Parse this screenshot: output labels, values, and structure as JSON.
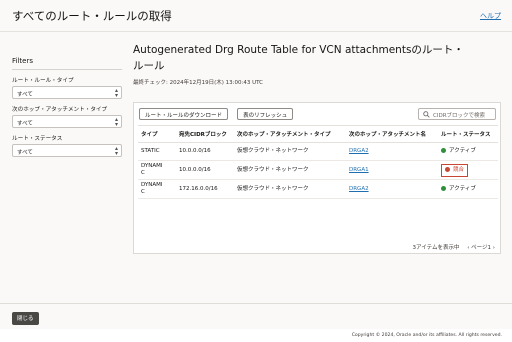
{
  "header": {
    "title": "すべてのルート・ルールの取得",
    "help": "ヘルプ"
  },
  "filters": {
    "title": "Filters",
    "groups": [
      {
        "label": "ルート・ルール・タイプ",
        "value": "すべて"
      },
      {
        "label": "次のホップ・アタッチメント・タイプ",
        "value": "すべて"
      },
      {
        "label": "ルート・ステータス",
        "value": "すべて"
      }
    ]
  },
  "main": {
    "title_line1": "Autogenerated Drg Route Table for VCN attachmentsのルート・",
    "title_line2": "ルール",
    "last_check": "最終チェック: 2024年12月19日(木) 13:00:43 UTC"
  },
  "toolbar": {
    "download_label": "ルート・ルールのダウンロード",
    "refresh_label": "表のリフレッシュ",
    "search_placeholder": "CIDRブロックで検索"
  },
  "table": {
    "headers": [
      "タイプ",
      "宛先CIDRブロック",
      "次のホップ・アタッチメント・タイプ",
      "次のホップ・アタッチメント名",
      "ルート・ステータス"
    ],
    "rows": [
      {
        "type": "STATIC",
        "cidr": "10.0.0.0/16",
        "hop_type": "仮想クラウド・ネットワーク",
        "hop_name": "DRGA2",
        "status": "アクティブ",
        "status_kind": "active"
      },
      {
        "type_l1": "DYNAMI",
        "type_l2": "C",
        "cidr": "10.0.0.0/16",
        "hop_type": "仮想クラウド・ネットワーク",
        "hop_name": "DRGA1",
        "status": "競合",
        "status_kind": "conflict"
      },
      {
        "type_l1": "DYNAMI",
        "type_l2": "C",
        "cidr": "172.16.0.0/16",
        "hop_type": "仮想クラウド・ネットワーク",
        "hop_name": "DRGA2",
        "status": "アクティブ",
        "status_kind": "active"
      }
    ]
  },
  "pagination": {
    "count": "3アイテムを表示中",
    "page": "ページ1"
  },
  "bottom": {
    "close_label": "閉じる"
  },
  "footer": {
    "copyright": "Copyright © 2024, Oracle and/or its affiliates. All rights reserved."
  },
  "colors": {
    "active": "#2f8f3a",
    "conflict": "#c74634",
    "link": "#1f6fb0"
  }
}
